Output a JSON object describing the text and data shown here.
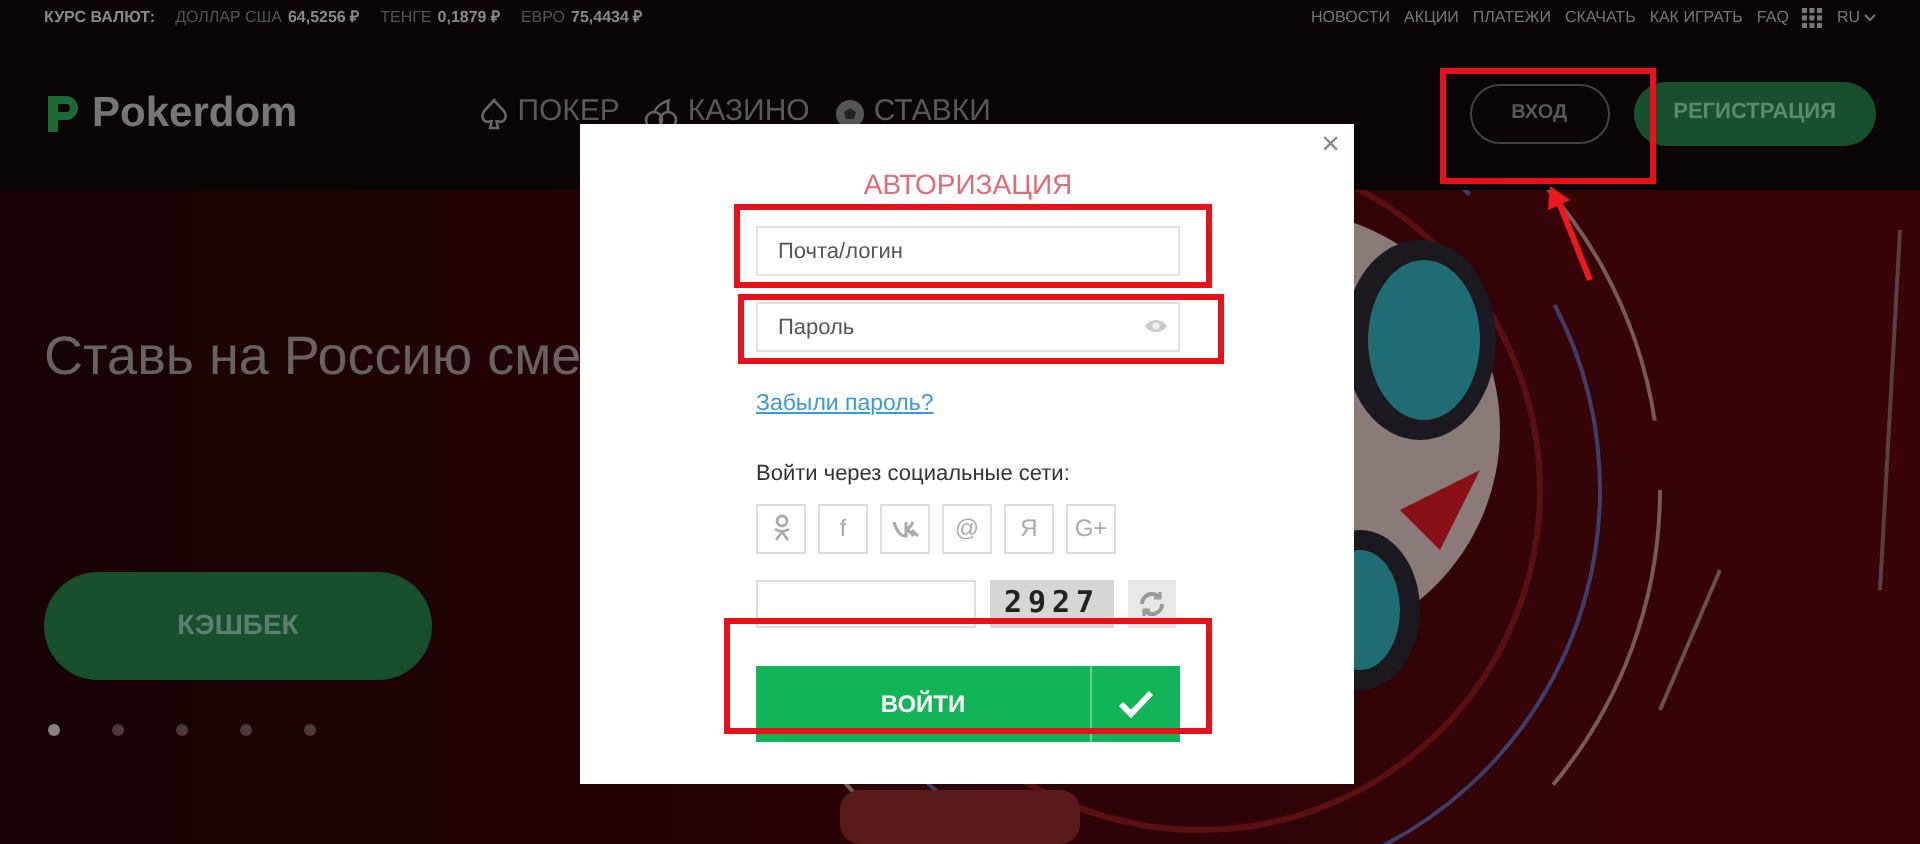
{
  "topbar": {
    "rates_label": "КУРС ВАЛЮТ:",
    "rates": [
      {
        "name": "ДОЛЛАР США",
        "value": "64,5256 ₽"
      },
      {
        "name": "ТЕНГЕ",
        "value": "0,1879 ₽"
      },
      {
        "name": "ЕВРО",
        "value": "75,4434 ₽"
      }
    ],
    "links": [
      "НОВОСТИ",
      "АКЦИИ",
      "ПЛАТЕЖИ",
      "СКАЧАТЬ",
      "КАК ИГРАТЬ",
      "FAQ"
    ],
    "language": "RU"
  },
  "header": {
    "logo": "Pokerdom",
    "nav": [
      {
        "kind": "spade",
        "label": "ПОКЕР"
      },
      {
        "kind": "cherry",
        "label": "КАЗИНО"
      },
      {
        "kind": "ball",
        "label": "СТАВКИ"
      }
    ],
    "login_button": "ВХОД",
    "register_button": "РЕГИСТРАЦИЯ"
  },
  "hero": {
    "title": "Ставь на Россию сме",
    "button": "КЭШБЕК",
    "dots": [
      {
        "selected": true
      },
      {
        "selected": false
      },
      {
        "selected": false
      },
      {
        "selected": false
      },
      {
        "selected": false
      }
    ]
  },
  "modal": {
    "title": "АВТОРИЗАЦИЯ",
    "close": "×",
    "login": {
      "placeholder": "Почта/логин"
    },
    "password": {
      "placeholder": "Пароль"
    },
    "forgot_link": "Забыли пароль?",
    "social_label": "Войти через социальные сети:",
    "social": [
      {
        "kind": "ok"
      },
      {
        "kind": "text",
        "label": "f"
      },
      {
        "kind": "vk"
      },
      {
        "kind": "text",
        "label": "@"
      },
      {
        "kind": "text",
        "label": "Я"
      },
      {
        "kind": "text",
        "label": "G+"
      }
    ],
    "captcha": "2927",
    "submit": "ВОЙТИ"
  }
}
